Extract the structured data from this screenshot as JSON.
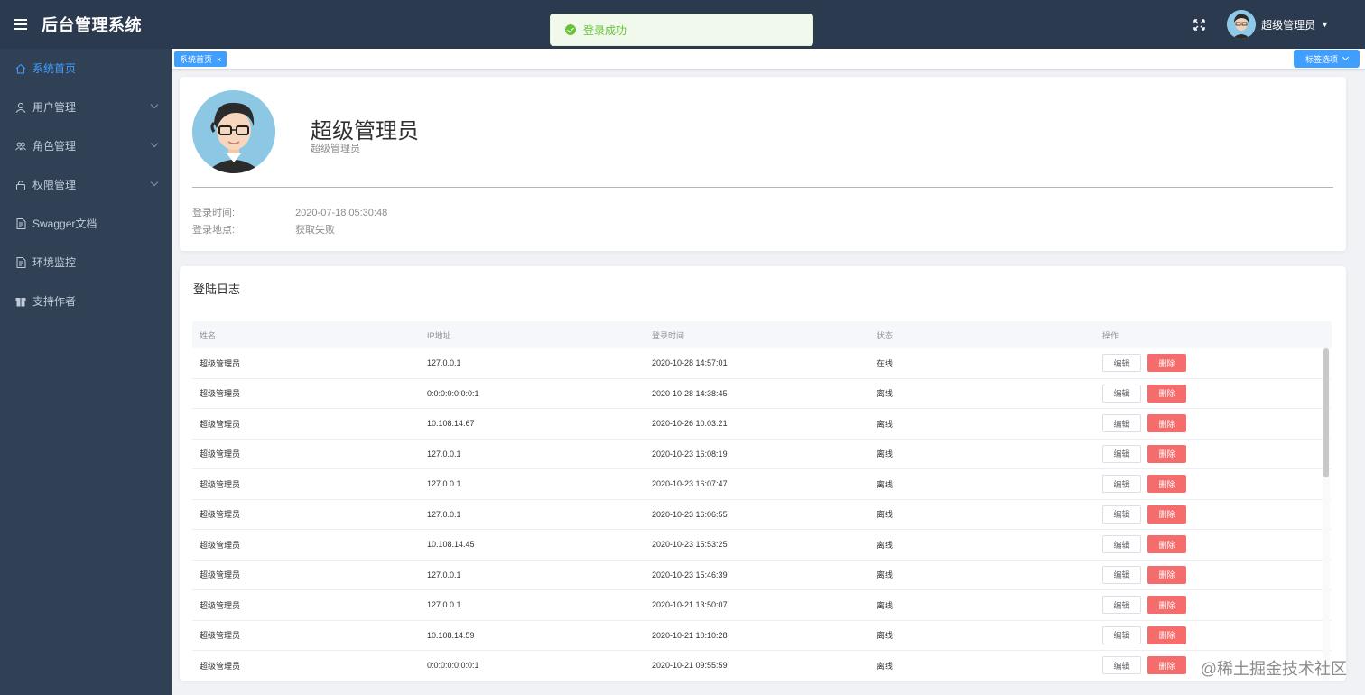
{
  "header": {
    "title": "后台管理系统",
    "user_name": "超级管理员"
  },
  "toast": {
    "message": "登录成功",
    "color": "#67c23a"
  },
  "sidebar": {
    "items": [
      {
        "label": "系统首页",
        "icon": "home-icon",
        "active": true
      },
      {
        "label": "用户管理",
        "icon": "user-icon",
        "expandable": true
      },
      {
        "label": "角色管理",
        "icon": "users-icon",
        "expandable": true
      },
      {
        "label": "权限管理",
        "icon": "lock-icon",
        "expandable": true
      },
      {
        "label": "Swagger文档",
        "icon": "document-icon"
      },
      {
        "label": "环境监控",
        "icon": "document-icon"
      },
      {
        "label": "支持作者",
        "icon": "gift-icon"
      }
    ]
  },
  "tags": {
    "active_tag": "系统首页",
    "options_label": "标签选项"
  },
  "profile": {
    "name": "超级管理员",
    "role": "超级管理员",
    "login_time_label": "登录时间:",
    "login_time": "2020-07-18 05:30:48",
    "login_location_label": "登录地点:",
    "login_location": "获取失败"
  },
  "log": {
    "title": "登陆日志",
    "columns": [
      "姓名",
      "IP地址",
      "登录时间",
      "状态",
      "操作"
    ],
    "edit_label": "编辑",
    "delete_label": "删除",
    "rows": [
      {
        "name": "超级管理员",
        "ip": "127.0.0.1",
        "time": "2020-10-28 14:57:01",
        "status": "在线"
      },
      {
        "name": "超级管理员",
        "ip": "0:0:0:0:0:0:0:1",
        "time": "2020-10-28 14:38:45",
        "status": "离线"
      },
      {
        "name": "超级管理员",
        "ip": "10.108.14.67",
        "time": "2020-10-26 10:03:21",
        "status": "离线"
      },
      {
        "name": "超级管理员",
        "ip": "127.0.0.1",
        "time": "2020-10-23 16:08:19",
        "status": "离线"
      },
      {
        "name": "超级管理员",
        "ip": "127.0.0.1",
        "time": "2020-10-23 16:07:47",
        "status": "离线"
      },
      {
        "name": "超级管理员",
        "ip": "127.0.0.1",
        "time": "2020-10-23 16:06:55",
        "status": "离线"
      },
      {
        "name": "超级管理员",
        "ip": "10.108.14.45",
        "time": "2020-10-23 15:53:25",
        "status": "离线"
      },
      {
        "name": "超级管理员",
        "ip": "127.0.0.1",
        "time": "2020-10-23 15:46:39",
        "status": "离线"
      },
      {
        "name": "超级管理员",
        "ip": "127.0.0.1",
        "time": "2020-10-21 13:50:07",
        "status": "离线"
      },
      {
        "name": "超级管理员",
        "ip": "10.108.14.59",
        "time": "2020-10-21 10:10:28",
        "status": "离线"
      },
      {
        "name": "超级管理员",
        "ip": "0:0:0:0:0:0:0:1",
        "time": "2020-10-21 09:55:59",
        "status": "离线"
      }
    ]
  },
  "watermark": "@稀土掘金技术社区",
  "colors": {
    "header_bg": "#2b3a4e",
    "sidebar_bg": "#304156",
    "primary": "#409eff",
    "danger": "#f56c6c"
  }
}
